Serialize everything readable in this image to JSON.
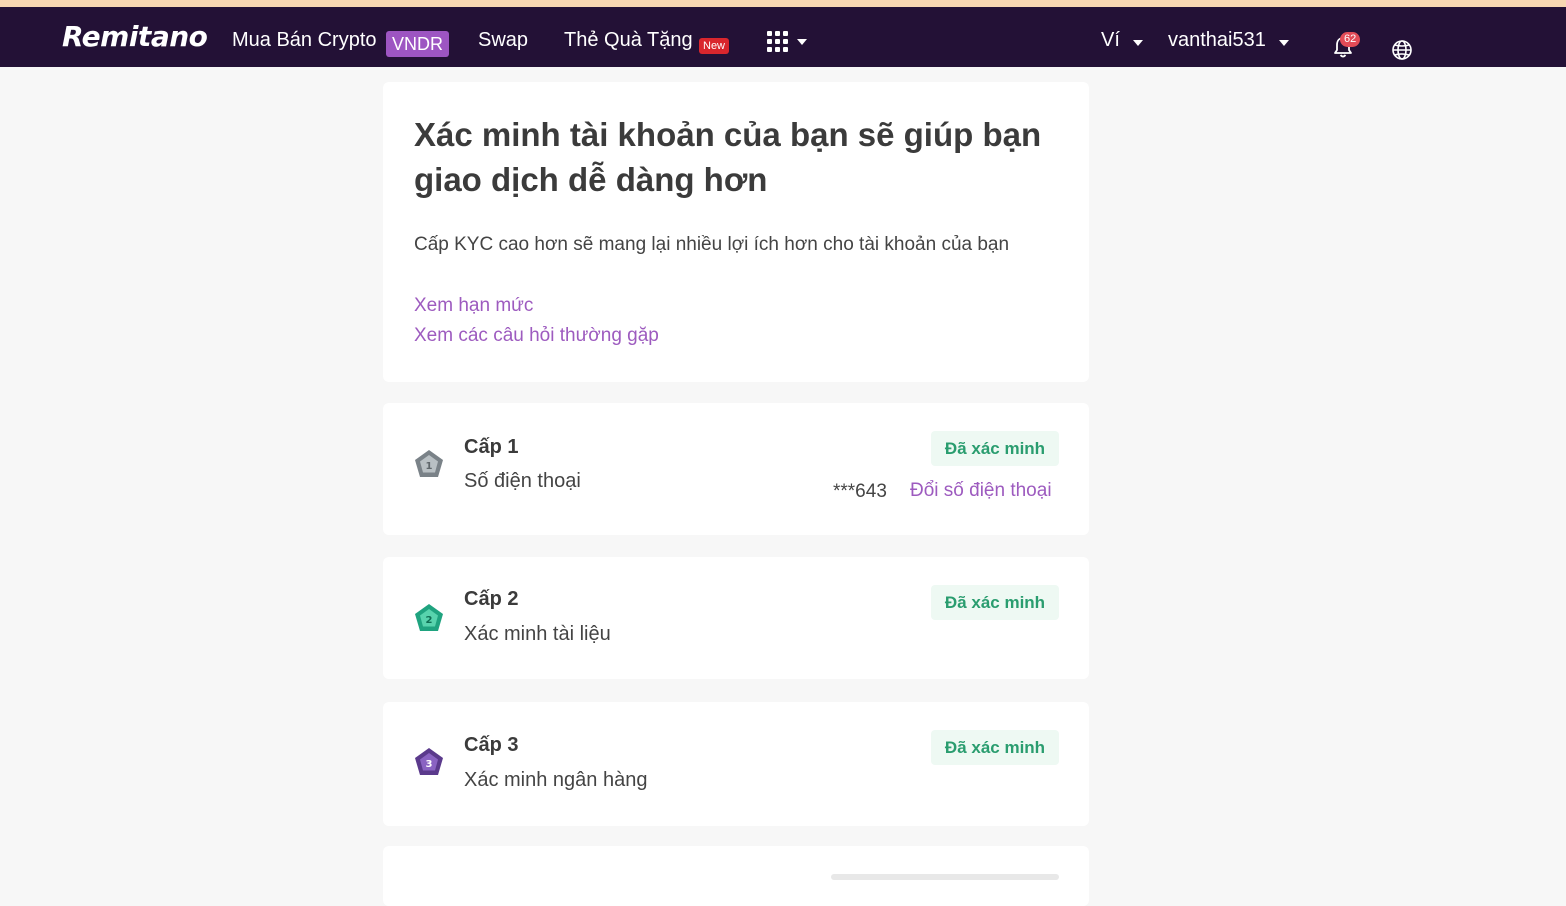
{
  "navbar": {
    "logo": "Remitano",
    "buy_sell_label": "Mua Bán Crypto",
    "vndr_badge": "VNDR",
    "swap_label": "Swap",
    "gift_card_label": "Thẻ Quà Tặng",
    "new_badge": "New",
    "wallet_label": "Ví",
    "username": "vanthai531",
    "notification_count": "62"
  },
  "intro": {
    "title": "Xác minh tài khoản của bạn sẽ giúp bạn giao dịch dễ dàng hơn",
    "subtitle": "Cấp KYC cao hơn sẽ mang lại nhiều lợi ích hơn cho tài khoản của bạn",
    "link_limits": "Xem hạn mức",
    "link_faq": "Xem các câu hỏi thường gặp"
  },
  "levels": [
    {
      "title": "Cấp 1",
      "badge_number": "1",
      "description": "Số điện thoại",
      "status": "Đã xác minh",
      "phone_masked": "***643",
      "change_phone": "Đổi số điện thoại",
      "color": "#7a8288"
    },
    {
      "title": "Cấp 2",
      "badge_number": "2",
      "description": "Xác minh tài liệu",
      "status": "Đã xác minh",
      "color": "#1fa37f"
    },
    {
      "title": "Cấp 3",
      "badge_number": "3",
      "description": "Xác minh ngân hàng",
      "status": "Đã xác minh",
      "color": "#5b3a8c"
    }
  ],
  "colors": {
    "navbar_bg": "#231136",
    "accent_purple": "#9d5bbf",
    "verified_green": "#2a9d6f",
    "new_red": "#d9262d"
  }
}
